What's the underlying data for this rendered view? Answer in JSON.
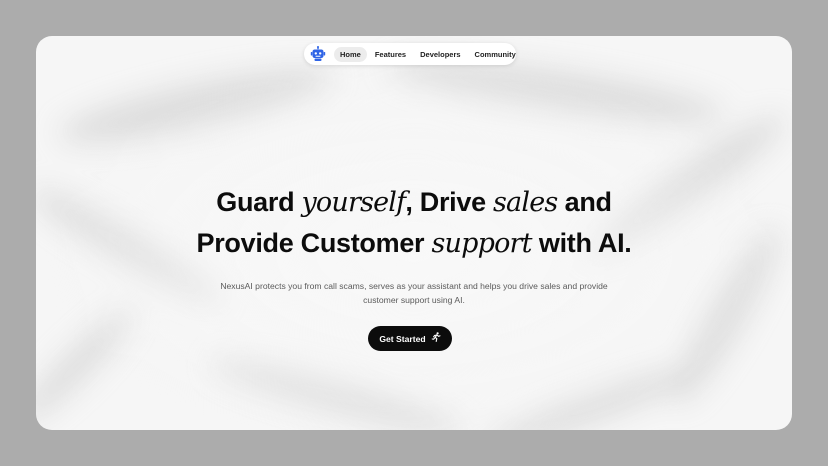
{
  "nav": {
    "logo_icon": "robot-icon",
    "items": [
      {
        "label": "Home",
        "active": true
      },
      {
        "label": "Features",
        "active": false
      },
      {
        "label": "Developers",
        "active": false
      },
      {
        "label": "Community",
        "active": false
      }
    ]
  },
  "hero": {
    "title_parts": {
      "p1": "Guard ",
      "p2": "yourself",
      "p3": ", Drive ",
      "p4": "sales",
      "p5": " and",
      "p6": "Provide Customer ",
      "p7": "support",
      "p8": " with AI."
    },
    "subtitle_line1": "NexusAI protects you from call scams, serves as your assistant and helps you drive sales and provide",
    "subtitle_line2": "customer support using AI.",
    "cta_label": "Get Started",
    "cta_icon": "running-person-icon"
  },
  "colors": {
    "page_bg": "#acacac",
    "card_bg": "#f6f6f6",
    "text": "#0c0c0c",
    "muted": "#5a5a5a",
    "accent": "#2f64e6",
    "button_bg": "#0c0c0c"
  }
}
